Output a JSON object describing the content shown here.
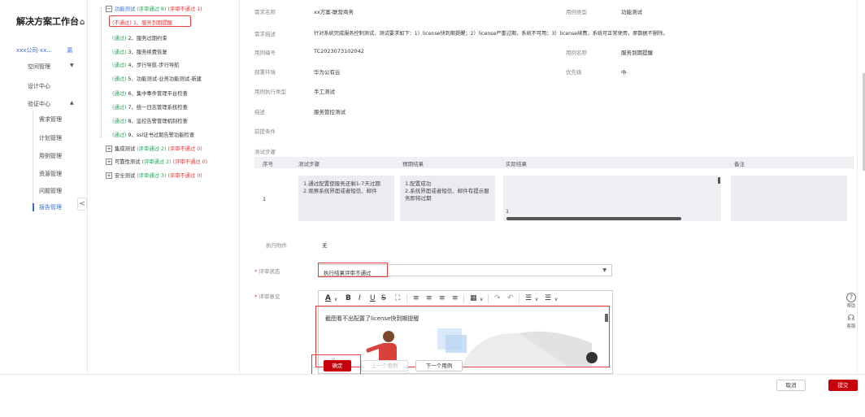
{
  "sidebar": {
    "title": "解决方案工作台",
    "org": "xxx公司-xx...",
    "org_switch": "漏",
    "items": [
      {
        "label": "空间管理"
      },
      {
        "label": "设计中心"
      },
      {
        "label": "验证中心"
      }
    ],
    "subitems": [
      {
        "label": "需求管理"
      },
      {
        "label": "计划管理"
      },
      {
        "label": "用例管理"
      },
      {
        "label": "资源管理"
      },
      {
        "label": "问题管理"
      },
      {
        "label": "报告管理"
      }
    ],
    "collapse": "<"
  },
  "tree": {
    "group_top": {
      "label": "功能测试",
      "stats": "(评审通过 8)",
      "stats_fail": "(评审不通过 1)"
    },
    "items": [
      {
        "status": "(不通过)",
        "label": "1、服务到期提醒"
      },
      {
        "status": "(通过)",
        "label": "2、服务过期约束"
      },
      {
        "status": "(通过)",
        "label": "3、服务续费恢复"
      },
      {
        "status": "(通过)",
        "label": "4、步行导航-步行导航"
      },
      {
        "status": "(通过)",
        "label": "5、功能测试-业务功能测试-新建"
      },
      {
        "status": "(通过)",
        "label": "6、集中事件管理平台检查"
      },
      {
        "status": "(通过)",
        "label": "7、统一日志管理系统检查"
      },
      {
        "status": "(通过)",
        "label": "8、监控告警管理机制检查"
      },
      {
        "status": "(通过)",
        "label": "9、ssl证书过期告警功能检查"
      }
    ],
    "groups": [
      {
        "label": "集成测试",
        "stats": "(评审通过 2)",
        "stats_fail": "(评审不通过 0)"
      },
      {
        "label": "可靠性测试",
        "stats": "(评审通过 2)",
        "stats_fail": "(评审不通过 0)"
      },
      {
        "label": "安全测试",
        "stats": "(评审通过 3)",
        "stats_fail": "(评审不通过 0)"
      }
    ]
  },
  "detail": {
    "req_name_label": "需求名称",
    "req_name": "xx方案-联营商务",
    "case_type_label": "用例类型",
    "case_type": "功能测试",
    "req_desc_label": "需求描述",
    "req_desc": "针对系统完成服务控制测试，测试要求如下：1）license快到期提醒；2）license严重过期，系统不可用；3）license续费，系统可正常使用，原数据不删除。",
    "case_no_label": "用例编号",
    "case_no": "TC2023073102042",
    "case_name_label": "用例名称",
    "case_name": "服务到期提醒",
    "env_label": "部署环境",
    "env": "华为公有云",
    "priority_label": "优先级",
    "priority": "中",
    "exec_type_label": "用例执行类型",
    "exec_type": "手工测试",
    "desc_label": "描述",
    "desc": "服务管控测试",
    "precond_label": "前提条件",
    "steps_label": "测试步骤",
    "steps_headers": [
      "序号",
      "测试步骤",
      "预期结果",
      "实际结果",
      "备注"
    ],
    "steps": [
      {
        "no": "1",
        "step_lines": [
          "1.通过配置使服务还剩1-7天过期",
          "2.观察系统界面或者短信、邮件"
        ],
        "expected_lines": [
          "1.配置成功",
          "2.系统界面或者短信、邮件有提示服",
          "务即将过期"
        ],
        "actual": "1",
        "note": ""
      }
    ],
    "attach_label": "执行附件",
    "attach": "无",
    "review_status_label": "评审状态",
    "review_status": "执行结果评审不通过",
    "review_comment_label": "评审意见",
    "comment_text": "截图看不出配置了license快到期提醒"
  },
  "buttons": {
    "confirm": "确定",
    "prev": "上一个用例",
    "next": "下一个用例",
    "cancel": "取消",
    "submit": "提交"
  },
  "help": {
    "help": "帮助",
    "service": "客服"
  },
  "colors": {
    "primary": "#c7000b",
    "pass": "#29a35a",
    "fail": "#e23b3b",
    "link": "#3b6fd6"
  }
}
